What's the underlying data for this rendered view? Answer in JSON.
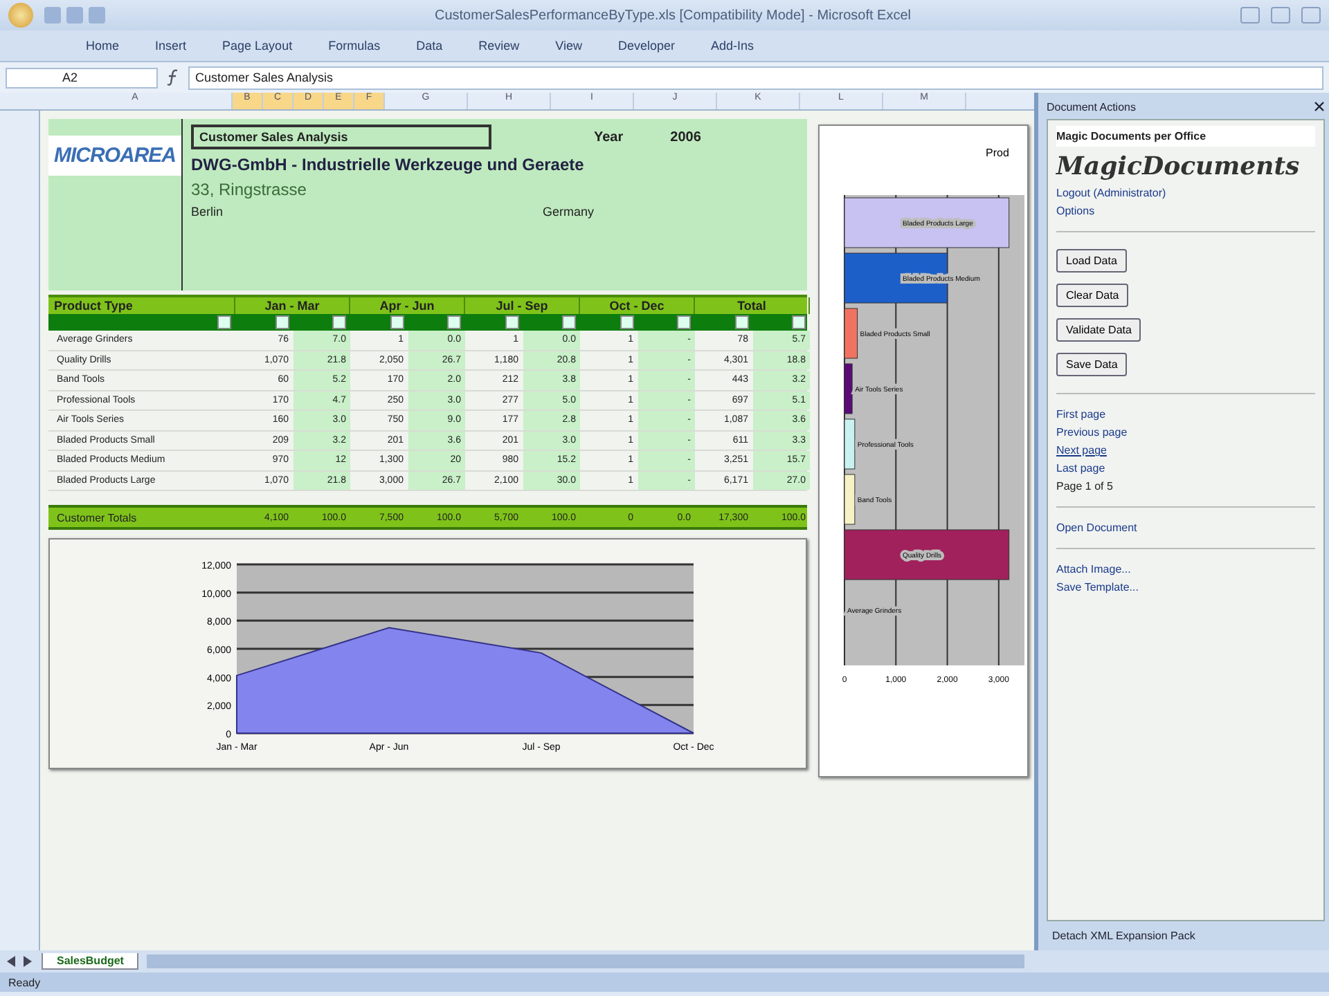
{
  "window": {
    "title": "CustomerSalesPerformanceByType.xls [Compatibility Mode] - Microsoft Excel"
  },
  "ribbon_tabs": [
    {
      "label": "Home",
      "selected": false
    },
    {
      "label": "Insert",
      "selected": false
    },
    {
      "label": "Page Layout",
      "selected": false
    },
    {
      "label": "Formulas",
      "selected": false
    },
    {
      "label": "Data",
      "selected": false
    },
    {
      "label": "Review",
      "selected": false
    },
    {
      "label": "View",
      "selected": false
    },
    {
      "label": "Developer",
      "selected": false
    },
    {
      "label": "Add-Ins",
      "selected": false
    }
  ],
  "formula_bar": {
    "name_box": "A2",
    "value": "Customer Sales Analysis"
  },
  "columns": [
    {
      "label": "A",
      "selected": false
    },
    {
      "label": "B",
      "selected": true
    },
    {
      "label": "C",
      "selected": true
    },
    {
      "label": "D",
      "selected": true
    },
    {
      "label": "E",
      "selected": true
    },
    {
      "label": "F",
      "selected": true
    },
    {
      "label": "G",
      "selected": false
    },
    {
      "label": "H",
      "selected": false
    },
    {
      "label": "I",
      "selected": false
    },
    {
      "label": "J",
      "selected": false
    },
    {
      "label": "K",
      "selected": false
    },
    {
      "label": "L",
      "selected": false
    },
    {
      "label": "M",
      "selected": false
    }
  ],
  "header": {
    "logo": "MICROAREA",
    "title": "Customer Sales Analysis",
    "year_label": "Year",
    "year": "2006",
    "company": "DWG-GmbH - Industrielle Werkzeuge und Geraete",
    "street": "33, Ringstrasse",
    "city": "Berlin",
    "country": "Germany"
  },
  "table": {
    "columns": [
      "Product Type",
      "Jan - Mar",
      "Apr - Jun",
      "Jul - Sep",
      "Oct - Dec",
      "Total"
    ],
    "rows": [
      {
        "name": "Average Grinders",
        "periods": [
          {
            "amount": "76",
            "share": "7.0"
          },
          {
            "amount": "1",
            "share": "0.0"
          },
          {
            "amount": "1",
            "share": "0.0"
          },
          {
            "amount": "1",
            "share": "-"
          },
          {
            "amount": "78",
            "share": "5.7"
          }
        ]
      },
      {
        "name": "Quality Drills",
        "periods": [
          {
            "amount": "1,070",
            "share": "21.8"
          },
          {
            "amount": "2,050",
            "share": "26.7"
          },
          {
            "amount": "1,180",
            "share": "20.8"
          },
          {
            "amount": "1",
            "share": "-"
          },
          {
            "amount": "4,301",
            "share": "18.8"
          }
        ]
      },
      {
        "name": "Band Tools",
        "periods": [
          {
            "amount": "60",
            "share": "5.2"
          },
          {
            "amount": "170",
            "share": "2.0"
          },
          {
            "amount": "212",
            "share": "3.8"
          },
          {
            "amount": "1",
            "share": "-"
          },
          {
            "amount": "443",
            "share": "3.2"
          }
        ]
      },
      {
        "name": "Professional Tools",
        "periods": [
          {
            "amount": "170",
            "share": "4.7"
          },
          {
            "amount": "250",
            "share": "3.0"
          },
          {
            "amount": "277",
            "share": "5.0"
          },
          {
            "amount": "1",
            "share": "-"
          },
          {
            "amount": "697",
            "share": "5.1"
          }
        ]
      },
      {
        "name": "Air Tools Series",
        "periods": [
          {
            "amount": "160",
            "share": "3.0"
          },
          {
            "amount": "750",
            "share": "9.0"
          },
          {
            "amount": "177",
            "share": "2.8"
          },
          {
            "amount": "1",
            "share": "-"
          },
          {
            "amount": "1,087",
            "share": "3.6"
          }
        ]
      },
      {
        "name": "Bladed Products Small",
        "periods": [
          {
            "amount": "209",
            "share": "3.2"
          },
          {
            "amount": "201",
            "share": "3.6"
          },
          {
            "amount": "201",
            "share": "3.0"
          },
          {
            "amount": "1",
            "share": "-"
          },
          {
            "amount": "611",
            "share": "3.3"
          }
        ]
      },
      {
        "name": "Bladed Products Medium",
        "periods": [
          {
            "amount": "970",
            "share": "12"
          },
          {
            "amount": "1,300",
            "share": "20"
          },
          {
            "amount": "980",
            "share": "15.2"
          },
          {
            "amount": "1",
            "share": "-"
          },
          {
            "amount": "3,251",
            "share": "15.7"
          }
        ]
      },
      {
        "name": "Bladed Products Large",
        "periods": [
          {
            "amount": "1,070",
            "share": "21.8"
          },
          {
            "amount": "3,000",
            "share": "26.7"
          },
          {
            "amount": "2,100",
            "share": "30.0"
          },
          {
            "amount": "1",
            "share": "-"
          },
          {
            "amount": "6,171",
            "share": "27.0"
          }
        ]
      }
    ],
    "totals": {
      "label": "Customer Totals",
      "periods": [
        {
          "amount": "4,100",
          "share": "100.0"
        },
        {
          "amount": "7,500",
          "share": "100.0"
        },
        {
          "amount": "5,700",
          "share": "100.0"
        },
        {
          "amount": "0",
          "share": "0.0"
        },
        {
          "amount": "17,300",
          "share": "100.0"
        }
      ]
    }
  },
  "sales_chart": {
    "chart_data": {
      "type": "area",
      "grid": true,
      "categories": [
        "Jan - Mar",
        "Apr - Jun",
        "Jul - Sep",
        "Oct - Dec"
      ],
      "series": [
        {
          "color": "#8484ee",
          "values": [
            4100,
            7500,
            5700,
            0
          ]
        }
      ],
      "ylim": [
        0,
        12000
      ],
      "yticks": [
        {
          "value": 0,
          "label": "0"
        },
        {
          "value": 2000,
          "label": "2,000"
        },
        {
          "value": 4000,
          "label": "4,000"
        },
        {
          "value": 6000,
          "label": "6,000"
        },
        {
          "value": 8000,
          "label": "8,000"
        },
        {
          "value": 10000,
          "label": "10,000"
        },
        {
          "value": 12000,
          "label": "12,000"
        }
      ]
    }
  },
  "product_chart": {
    "title": "Prod",
    "chart_data": {
      "type": "bar",
      "orientation": "horizontal",
      "stacked": true,
      "grid": true,
      "categories": [
        "Bladed Products Large",
        "Bladed Products Medium",
        "Bladed Products Small",
        "Air Tools Series",
        "Professional Tools",
        "Band Tools",
        "Quality Drills",
        "Average Grinders"
      ],
      "series": [
        {
          "color": "#c8c2f2",
          "values": [
            3200,
            null,
            null,
            null,
            null,
            null,
            null,
            null
          ]
        },
        {
          "color": "#1d5fc9",
          "values": [
            null,
            2000,
            null,
            null,
            null,
            null,
            null,
            null
          ]
        },
        {
          "color": "#f07362",
          "values": [
            null,
            null,
            250,
            null,
            null,
            null,
            null,
            null
          ]
        },
        {
          "color": "#5c0a78",
          "values": [
            null,
            null,
            null,
            150,
            null,
            null,
            null,
            null
          ]
        },
        {
          "color": "#c9f1f1",
          "values": [
            null,
            null,
            null,
            null,
            200,
            null,
            null,
            null
          ]
        },
        {
          "color": "#f6f2c6",
          "values": [
            null,
            null,
            null,
            null,
            null,
            200,
            null,
            null
          ]
        },
        {
          "color": "#a1215c",
          "values": [
            null,
            null,
            null,
            null,
            null,
            null,
            3200,
            null
          ]
        }
      ],
      "xlim": [
        0,
        3500
      ],
      "xticks": [
        {
          "value": 0,
          "label": "0"
        },
        {
          "value": 1000,
          "label": "1,000"
        },
        {
          "value": 2000,
          "label": "2,000"
        },
        {
          "value": 3000,
          "label": "3,000"
        }
      ]
    }
  },
  "task_pane": {
    "title": "Document Actions",
    "heading": "Magic Documents per Office",
    "logo": "MagicDocuments",
    "links": [
      "Logout (Administrator)",
      "Options"
    ],
    "buttons": [
      "Load Data",
      "Clear Data",
      "Validate Data",
      "Save Data"
    ],
    "navigation": [
      {
        "label": "First page",
        "selected": false
      },
      {
        "label": "Previous page",
        "selected": false
      },
      {
        "label": "Next page",
        "selected": true
      },
      {
        "label": "Last page",
        "selected": false
      }
    ],
    "page": "Page 1 of 5",
    "open": "Open Document",
    "actions": [
      "Attach Image...",
      "Save Template..."
    ],
    "footer": "Detach XML Expansion Pack"
  },
  "sheet_tabs": [
    {
      "label": "SalesBudget",
      "selected": true
    }
  ],
  "status_bar": {
    "text": "Ready"
  }
}
